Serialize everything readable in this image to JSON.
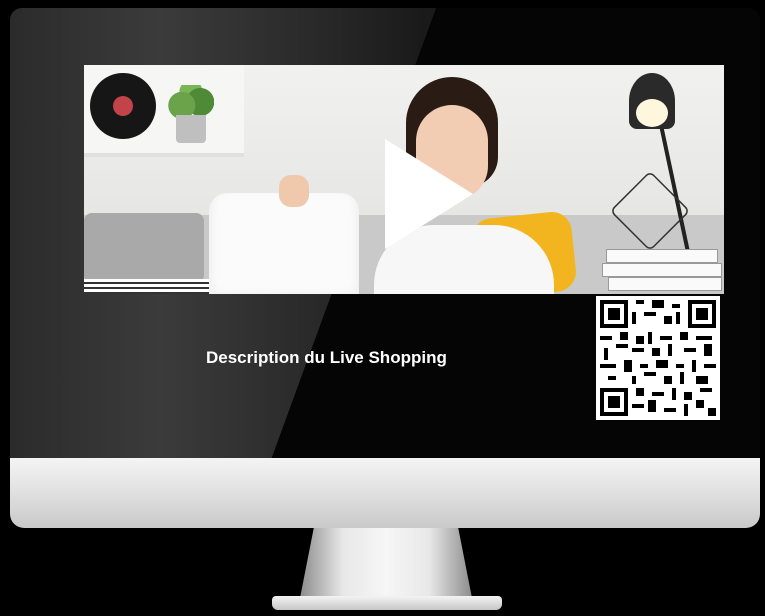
{
  "live": {
    "description": "Description du Live Shopping"
  },
  "icons": {
    "play": "play-icon",
    "qr": "qr-code-icon"
  },
  "colors": {
    "background": "#000000",
    "screen": "#050505",
    "text": "#ffffff",
    "accent_yellow": "#f2b51f",
    "record_label": "#c2434a"
  }
}
